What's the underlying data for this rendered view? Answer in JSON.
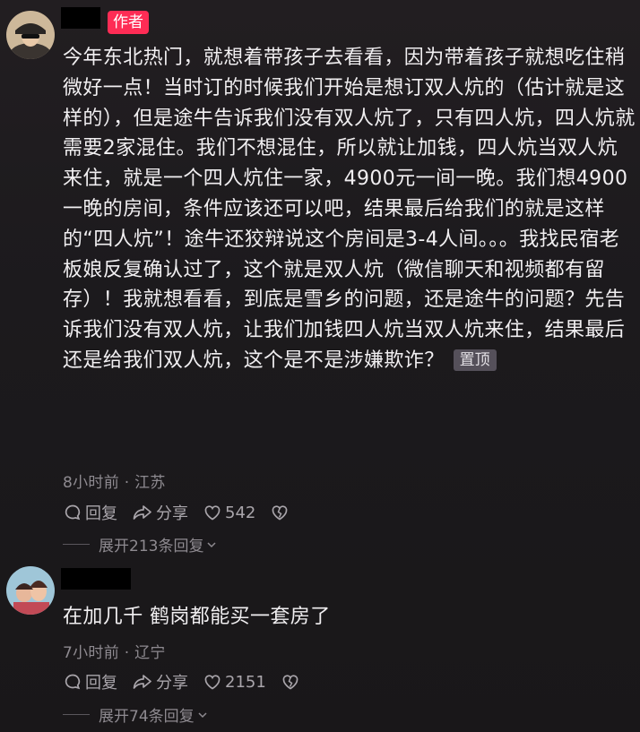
{
  "comments": [
    {
      "author_badge": "作者",
      "text": "今年东北热门，就想着带孩子去看看，因为带着孩子就想吃住稍微好一点！当时订的时候我们开始是想订双人炕的（估计就是这样的），但是途牛告诉我们没有双人炕了，只有四人炕，四人炕就需要2家混住。我们不想混住，所以就让加钱，四人炕当双人炕来住，就是一个四人炕住一家，4900元一间一晚。我们想4900一晚的房间，条件应该还可以吧，结果最后给我们的就是这样的“四人炕”！途牛还狡辩说这个房间是3-4人间。。。我找民宿老板娘反复确认过了，这个就是双人炕（微信聊天和视频都有留存）！我就想看看，到底是雪乡的问题，还是途牛的问题？先告诉我们没有双人炕，让我们加钱四人炕当双人炕来住，结果最后还是给我们双人炕，这个是不是涉嫌欺诈？",
      "pin_label": "置顶",
      "meta": "8小时前 · 江苏",
      "reply_label": "回复",
      "share_label": "分享",
      "like_count": "542",
      "expand_label": "展开213条回复"
    },
    {
      "text": "在加几千 鹤岗都能买一套房了",
      "meta": "7小时前 · 辽宁",
      "reply_label": "回复",
      "share_label": "分享",
      "like_count": "2151",
      "expand_label": "展开74条回复"
    }
  ]
}
